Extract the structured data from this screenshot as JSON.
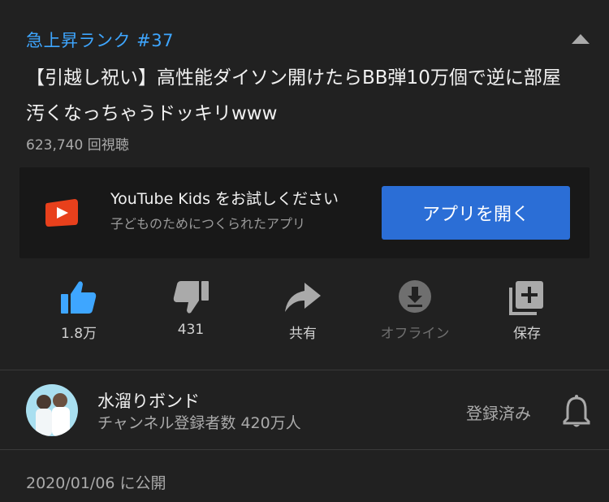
{
  "video": {
    "trending_label": "急上昇ランク #37",
    "title": "【引越し祝い】高性能ダイソン開けたらBB弾10万個で逆に部屋汚くなっちゃうドッキリwww",
    "views": "623,740 回視聴",
    "published": "2020/01/06 に公開"
  },
  "promo": {
    "title": "YouTube Kids をお試しください",
    "subtitle": "子どものためにつくられたアプリ",
    "button_label": "アプリを開く"
  },
  "actions": {
    "like": {
      "label": "1.8万",
      "icon": "thumbs-up-icon",
      "active": true
    },
    "dislike": {
      "label": "431",
      "icon": "thumbs-down-icon"
    },
    "share": {
      "label": "共有",
      "icon": "share-icon"
    },
    "offline": {
      "label": "オフライン",
      "icon": "download-icon",
      "disabled": true
    },
    "save": {
      "label": "保存",
      "icon": "playlist-add-icon"
    }
  },
  "channel": {
    "name": "水溜りボンド",
    "subscribers": "チャンネル登録者数 420万人",
    "subscribe_status": "登録済み"
  },
  "colors": {
    "background": "#212121",
    "accent": "#3ea6ff",
    "button": "#2b6ed6",
    "promo_bg": "#181818"
  }
}
